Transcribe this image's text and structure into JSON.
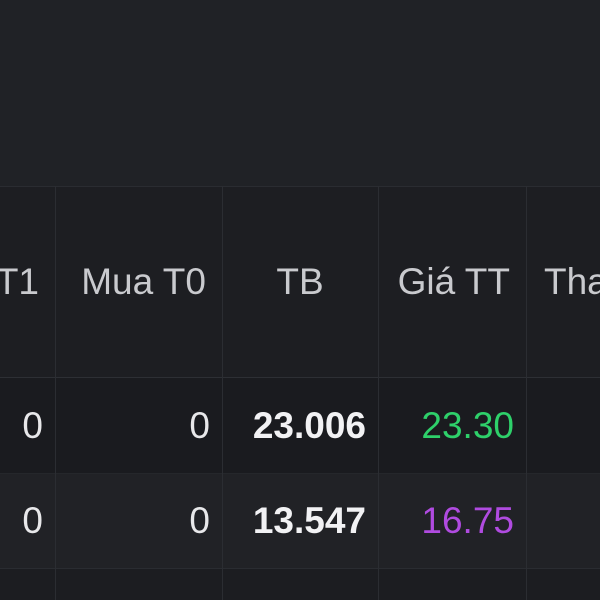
{
  "table": {
    "headers": {
      "col1": "T1",
      "col2": "Mua T0",
      "col3": "TB",
      "col4": "Giá TT",
      "col5": "Tha"
    },
    "rows": [
      {
        "col1": "0",
        "col2": "0",
        "col3": "23.006",
        "col4": "23.30",
        "col4_color": "#2ed06a"
      },
      {
        "col1": "0",
        "col2": "0",
        "col3": "13.547",
        "col4": "16.75",
        "col4_color": "#b04be0"
      }
    ]
  }
}
